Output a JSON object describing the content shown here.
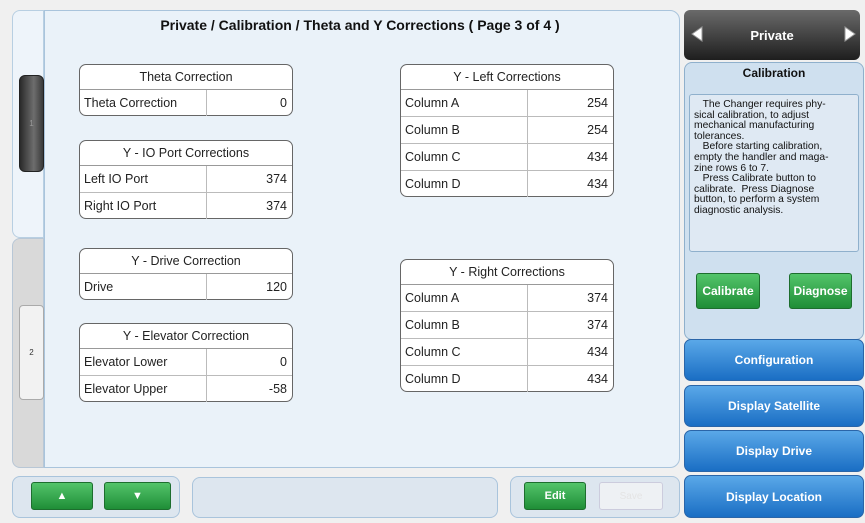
{
  "page": {
    "title": "Private / Calibration / Theta and Y Corrections ( Page 3 of 4 )"
  },
  "left_tabs": [
    {
      "label": "1"
    },
    {
      "label": "2"
    }
  ],
  "theta": {
    "title": "Theta Correction",
    "rows": [
      {
        "label": "Theta Correction",
        "value": "0"
      }
    ]
  },
  "io_port": {
    "title": "Y - IO Port Corrections",
    "rows": [
      {
        "label": "Left IO Port",
        "value": "374"
      },
      {
        "label": "Right IO Port",
        "value": "374"
      }
    ]
  },
  "drive": {
    "title": "Y - Drive Correction",
    "rows": [
      {
        "label": "Drive",
        "value": "120"
      }
    ]
  },
  "elevator": {
    "title": "Y - Elevator Correction",
    "rows": [
      {
        "label": "Elevator Lower",
        "value": "0"
      },
      {
        "label": "Elevator Upper",
        "value": "-58"
      }
    ]
  },
  "y_left": {
    "title": "Y - Left Corrections",
    "rows": [
      {
        "label": "Column A",
        "value": "254"
      },
      {
        "label": "Column B",
        "value": "254"
      },
      {
        "label": "Column C",
        "value": "434"
      },
      {
        "label": "Column D",
        "value": "434"
      }
    ]
  },
  "y_right": {
    "title": "Y - Right Corrections",
    "rows": [
      {
        "label": "Column A",
        "value": "374"
      },
      {
        "label": "Column B",
        "value": "374"
      },
      {
        "label": "Column C",
        "value": "434"
      },
      {
        "label": "Column D",
        "value": "434"
      }
    ]
  },
  "bottom": {
    "up_label": "▲",
    "down_label": "▼",
    "edit_label": "Edit",
    "save_label": "Save"
  },
  "sidebar": {
    "private_label": "Private",
    "calibration": {
      "title": "Calibration",
      "text": "   The Changer requires phy-\nsical calibration, to adjust\nmechanical manufacturing\ntolerances.\n   Before starting calibration,\nempty the handler and maga-\nzine rows 6 to 7.\n   Press Calibrate button to\ncalibrate.  Press Diagnose\nbutton, to perform a system\ndiagnostic analysis.",
      "calibrate_label": "Calibrate",
      "diagnose_label": "Diagnose"
    },
    "nav": [
      {
        "label": "Configuration"
      },
      {
        "label": "Display Satellite"
      },
      {
        "label": "Display Drive"
      },
      {
        "label": "Display Location"
      }
    ]
  },
  "colors": {
    "accent_blue": "#2a7fd0",
    "green": "#2aa344",
    "panel": "#eaf2f9"
  }
}
